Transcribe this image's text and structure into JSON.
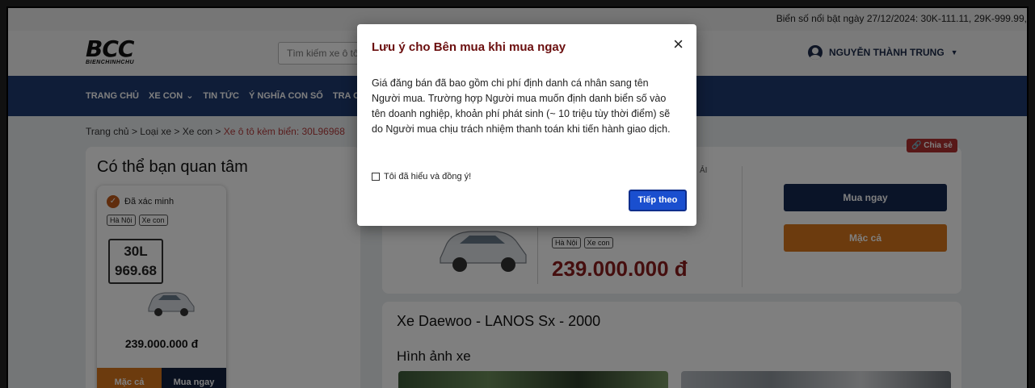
{
  "topbar": {
    "ticker": "Biển số nổi bật ngày 27/12/2024: 30K-111.11, 29K-999.99,"
  },
  "header": {
    "logo_mark": "BCC",
    "logo_sub": "BIENCHINHCHU",
    "search_placeholder": "Tìm kiếm xe ô tô",
    "user_name": "NGUYỄN THÀNH TRUNG"
  },
  "nav": {
    "items": [
      "TRANG CHỦ",
      "XE CON",
      "TIN TỨC",
      "Ý NGHĨA CON SỐ",
      "TRA CỨ"
    ]
  },
  "breadcrumb": {
    "home": "Trang chủ",
    "cat1": "Loại xe",
    "cat2": "Xe con",
    "current": "Xe ô tô kèm biển: 30L96968",
    "sep": ">"
  },
  "sidebar": {
    "title": "Có thể bạn quan tâm",
    "card": {
      "verified": "Đã xác minh",
      "tags": [
        "Hà Nội",
        "Xe con"
      ],
      "plate_line1": "30L",
      "plate_line2": "969.68",
      "price": "239.000.000 đ",
      "bargain": "Mặc cả",
      "buy": "Mua ngay"
    }
  },
  "listing": {
    "share": "Chia sẻ",
    "meta_fragment": "ẢI",
    "tags": [
      "Hà Nội",
      "Xe con"
    ],
    "price": "239.000.000 đ",
    "buy_now": "Mua ngay",
    "bargain": "Mặc cả"
  },
  "details": {
    "car_title": "Xe Daewoo - LANOS Sx - 2000",
    "images_title": "Hình ảnh xe"
  },
  "modal": {
    "title": "Lưu ý cho Bên mua khi mua ngay",
    "close": "×",
    "body": "Giá đăng bán đã bao gồm chi phí định danh cá nhân sang tên Người mua. Trường hợp Người mua muốn định danh biển số vào tên doanh nghiệp, khoản phí phát sinh (~ 10 triệu tùy thời điểm) sẽ do Người mua chịu trách nhiệm thanh toán khi tiến hành giao dịch.",
    "agree": "Tôi đã hiểu và đồng ý!",
    "next": "Tiếp theo"
  }
}
